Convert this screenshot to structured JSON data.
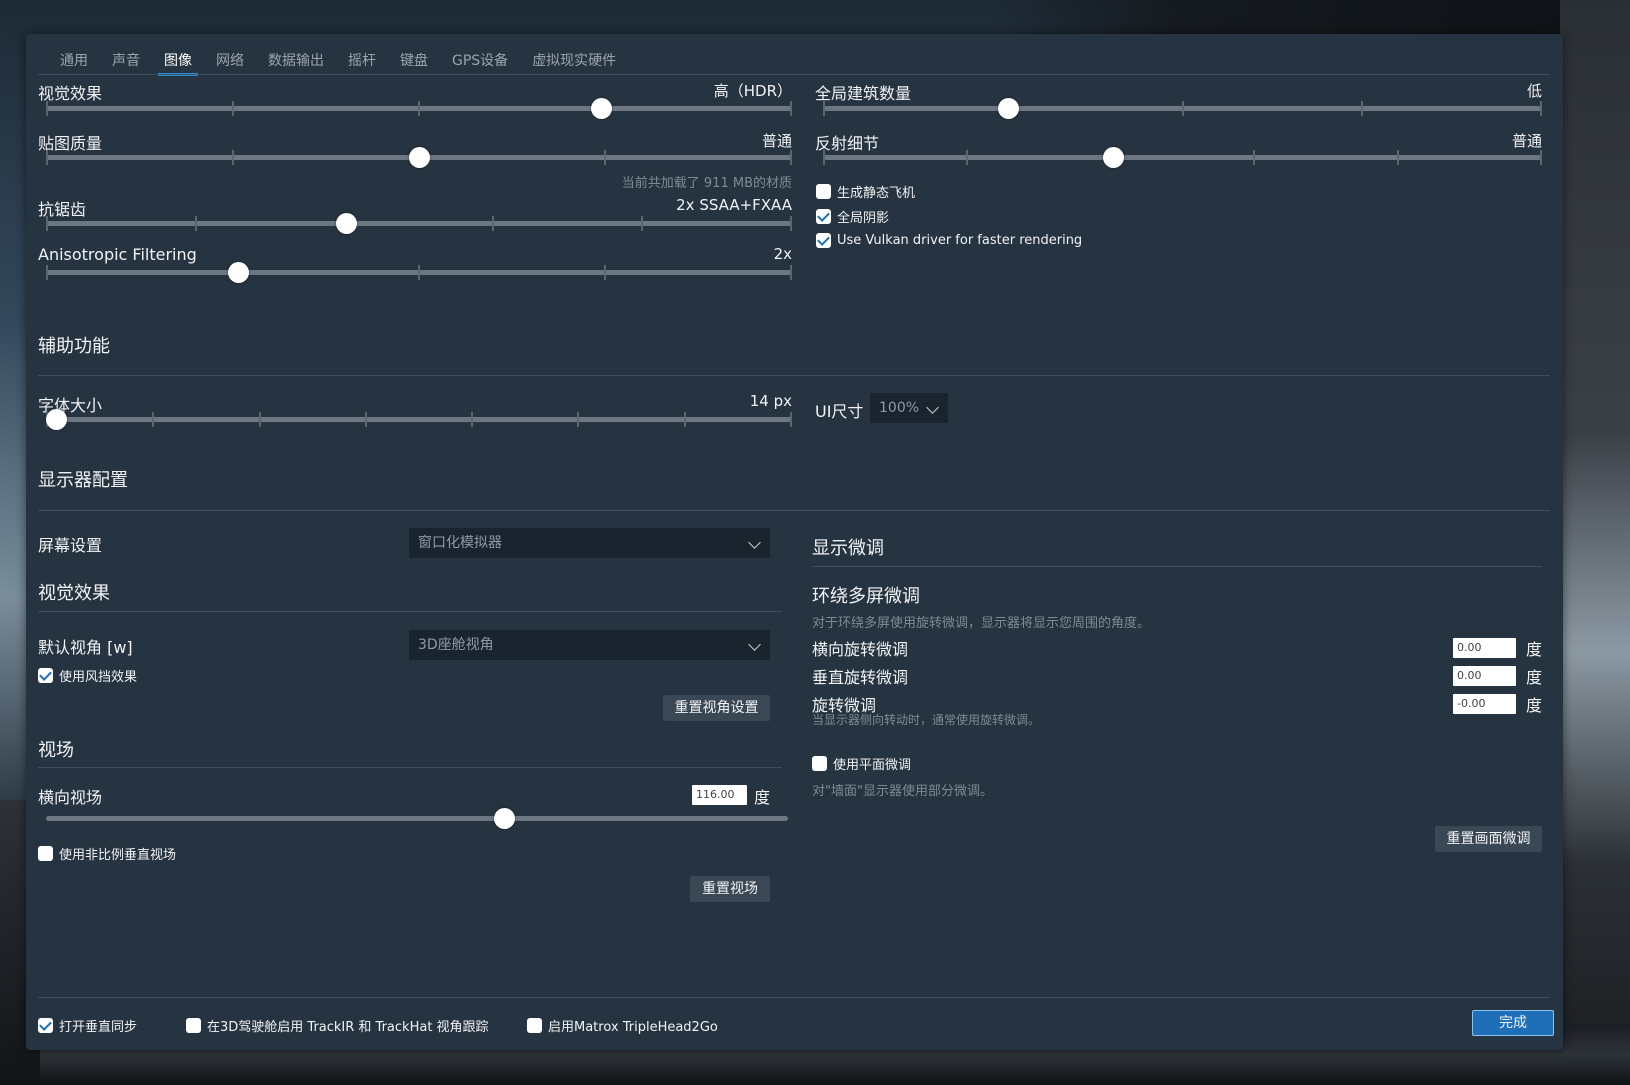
{
  "tabs": [
    "通用",
    "声音",
    "图像",
    "网络",
    "数据输出",
    "摇杆",
    "键盘",
    "GPS设备",
    "虚拟现实硬件"
  ],
  "active_tab": "图像",
  "graphics": {
    "visual_effects": {
      "label": "视觉效果",
      "value": "高（HDR）",
      "level": 0.75
    },
    "texture_quality": {
      "label": "贴图质量",
      "value": "普通",
      "level": 0.5,
      "note": "当前共加载了 911 MB的材质"
    },
    "antialiasing": {
      "label": "抗锯齿",
      "value": "2x SSAA+FXAA",
      "level": 0.4
    },
    "anisotropic": {
      "label": "Anisotropic Filtering",
      "value": "2x",
      "level": 0.25
    },
    "world_objects": {
      "label": "全局建筑数量",
      "value": "低",
      "level": 0.25
    },
    "reflection_detail": {
      "label": "反射细节",
      "value": "普通",
      "level": 0.4
    },
    "checkboxes": [
      {
        "label": "生成静态飞机",
        "checked": false
      },
      {
        "label": "全局阴影",
        "checked": true
      },
      {
        "label": "Use Vulkan driver for faster rendering",
        "checked": true
      }
    ]
  },
  "accessibility": {
    "title": "辅助功能",
    "font_size": {
      "label": "字体大小",
      "value": "14 px",
      "level": 0.0
    },
    "ui_size": {
      "label": "UI尺寸",
      "value": "100%"
    }
  },
  "monitor": {
    "title": "显示器配置",
    "screen_setting": {
      "label": "屏幕设置",
      "value": "窗口化模拟器"
    },
    "visual_title": "视觉效果",
    "default_view": {
      "label": "默认视角 [w]",
      "value": "3D座舱视角"
    },
    "windshield": {
      "label": "使用风挡效果",
      "checked": true
    },
    "reset_view_button": "重置视角设置",
    "fov_title": "视场",
    "horizontal_fov": {
      "label": "横向视场",
      "value": "116.00",
      "unit": "度",
      "level": 0.62
    },
    "non_proportional": {
      "label": "使用非比例垂直视场",
      "checked": false
    },
    "reset_fov_button": "重置视场"
  },
  "fine_tune": {
    "title": "显示微调",
    "surround_title": "环绕多屏微调",
    "surround_desc": "对于环绕多屏使用旋转微调，显示器将显示您周围的角度。",
    "lateral": {
      "label": "横向旋转微调",
      "value": "0.00",
      "unit": "度"
    },
    "vertical": {
      "label": "垂直旋转微调",
      "value": "0.00",
      "unit": "度"
    },
    "roll": {
      "label": "旋转微调",
      "value": "-0.00",
      "unit": "度",
      "note": "当显示器侧向转动时，通常使用旋转微调。"
    },
    "flat": {
      "label": "使用平面微调",
      "checked": false
    },
    "flat_desc": "对\"墙面\"显示器使用部分微调。",
    "reset_button": "重置画面微调"
  },
  "footer": {
    "vsync": {
      "label": "打开垂直同步",
      "checked": true
    },
    "trackir": {
      "label": "在3D驾驶舱启用 TrackIR 和 TrackHat 视角跟踪",
      "checked": false
    },
    "matrox": {
      "label": "启用Matrox TripleHead2Go",
      "checked": false
    },
    "done_button": "完成"
  }
}
